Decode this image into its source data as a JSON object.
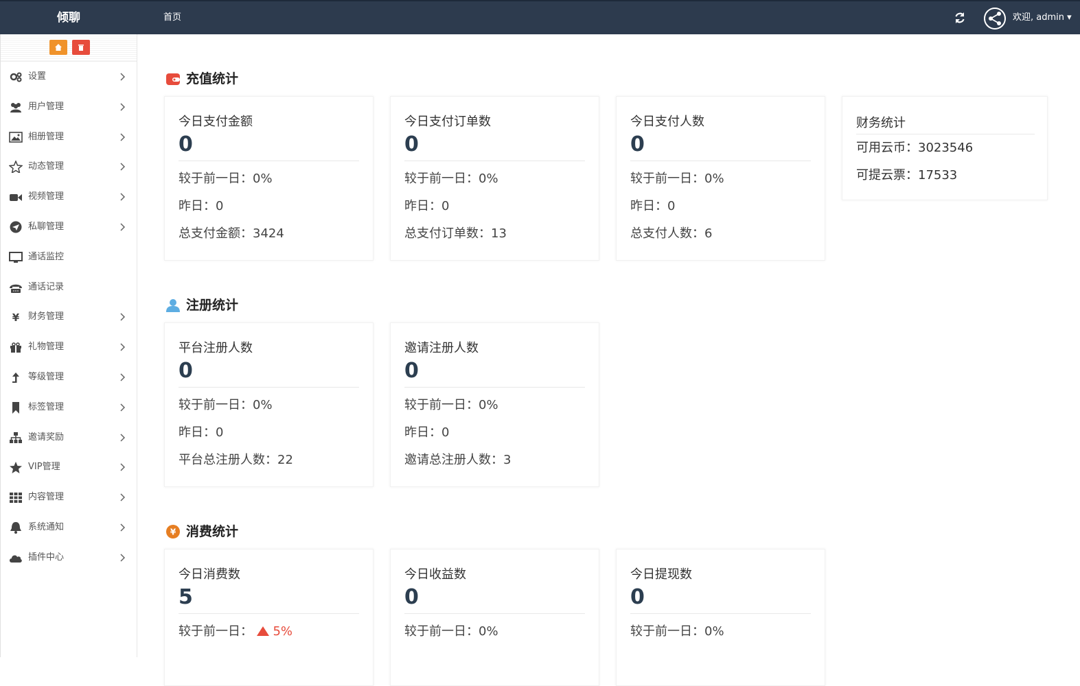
{
  "app": {
    "brand": "倾聊",
    "nav_home": "首页",
    "welcome": "欢迎, admin ▾"
  },
  "sidebar": {
    "items": [
      {
        "label": "设置",
        "icon": "gear-icon",
        "arrow": true
      },
      {
        "label": "用户管理",
        "icon": "users-icon",
        "arrow": true
      },
      {
        "label": "相册管理",
        "icon": "picture-icon",
        "arrow": true
      },
      {
        "label": "动态管理",
        "icon": "star-outline-icon",
        "arrow": true
      },
      {
        "label": "视频管理",
        "icon": "video-camera-icon",
        "arrow": true
      },
      {
        "label": "私聊管理",
        "icon": "paper-plane-icon",
        "arrow": true
      },
      {
        "label": "通话监控",
        "icon": "monitor-icon",
        "arrow": false
      },
      {
        "label": "通话记录",
        "icon": "phone-icon",
        "arrow": false
      },
      {
        "label": "财务管理",
        "icon": "yen-icon",
        "arrow": true
      },
      {
        "label": "礼物管理",
        "icon": "gift-icon",
        "arrow": true
      },
      {
        "label": "等级管理",
        "icon": "level-up-icon",
        "arrow": true
      },
      {
        "label": "标签管理",
        "icon": "bookmark-icon",
        "arrow": true
      },
      {
        "label": "邀请奖励",
        "icon": "sitemap-icon",
        "arrow": true
      },
      {
        "label": "VIP管理",
        "icon": "star-icon",
        "arrow": true
      },
      {
        "label": "内容管理",
        "icon": "grid-icon",
        "arrow": true
      },
      {
        "label": "系统通知",
        "icon": "bell-icon",
        "arrow": true
      },
      {
        "label": "插件中心",
        "icon": "cloud-icon",
        "arrow": true
      }
    ]
  },
  "recharge": {
    "title": "充值统计",
    "cards": [
      {
        "label": "今日支付金额",
        "value": "0",
        "compare": "较于前一日：0%",
        "yesterday": "昨日：0",
        "total": "总支付金额：3424"
      },
      {
        "label": "今日支付订单数",
        "value": "0",
        "compare": "较于前一日：0%",
        "yesterday": "昨日：0",
        "total": "总支付订单数：13"
      },
      {
        "label": "今日支付人数",
        "value": "0",
        "compare": "较于前一日：0%",
        "yesterday": "昨日：0",
        "total": "总支付人数：6"
      }
    ],
    "finance": {
      "title": "财务统计",
      "coins": "可用云币：3023546",
      "tickets": "可提云票：17533"
    }
  },
  "register": {
    "title": "注册统计",
    "cards": [
      {
        "label": "平台注册人数",
        "value": "0",
        "compare": "较于前一日：0%",
        "yesterday": "昨日：0",
        "total": "平台总注册人数：22"
      },
      {
        "label": "邀请注册人数",
        "value": "0",
        "compare": "较于前一日：0%",
        "yesterday": "昨日：0",
        "total": "邀请总注册人数：3"
      }
    ]
  },
  "consume": {
    "title": "消费统计",
    "cards": [
      {
        "label": "今日消费数",
        "value": "5",
        "compare_prefix": "较于前一日：",
        "compare_up": "5%"
      },
      {
        "label": "今日收益数",
        "value": "0",
        "compare": "较于前一日：0%"
      },
      {
        "label": "今日提现数",
        "value": "0",
        "compare": "较于前一日：0%"
      }
    ]
  },
  "colors": {
    "topbar": "#2d3b4e",
    "accent_orange": "#f0932b",
    "accent_red": "#e74c3c",
    "user_blue": "#5dade2",
    "yen_orange": "#e67e22"
  }
}
